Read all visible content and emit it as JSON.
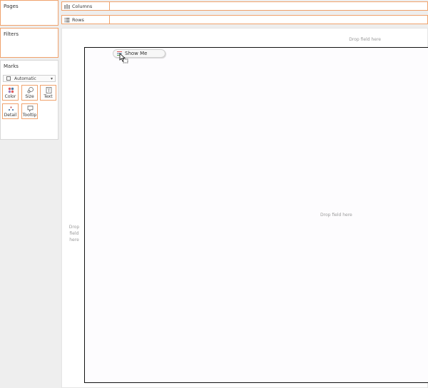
{
  "pages": {
    "title": "Pages"
  },
  "filters": {
    "title": "Filters"
  },
  "marks": {
    "title": "Marks",
    "mark_type": "Automatic",
    "buttons": {
      "color": "Color",
      "size": "Size",
      "text": "Text",
      "detail": "Detail",
      "tooltip": "Tooltip"
    }
  },
  "shelves": {
    "columns": "Columns",
    "rows": "Rows"
  },
  "view": {
    "columns_drop": "Drop field here",
    "rows_drop": "Drop field here",
    "canvas_drop": "Drop field here"
  },
  "show_me": {
    "label": "Show Me"
  },
  "colors": {
    "accent_border": "#f0a26c",
    "canvas_border": "#111111"
  }
}
